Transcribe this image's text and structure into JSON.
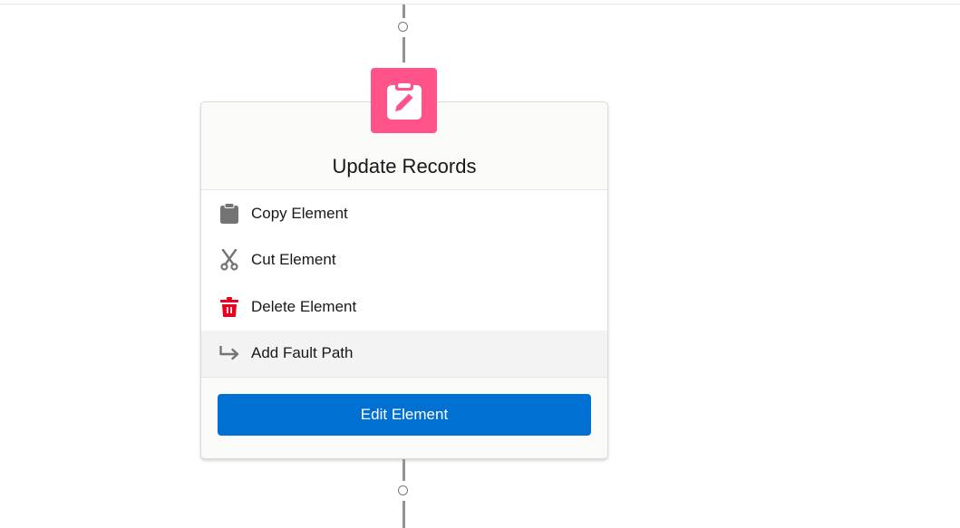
{
  "colors": {
    "element_icon_bg": "#ff538a",
    "primary_button": "#0070d2",
    "neutral_icon": "#747474",
    "delete_icon": "#ea001e"
  },
  "element": {
    "title": "Update Records",
    "icon": "clipboard-edit-icon"
  },
  "menu": {
    "items": [
      {
        "label": "Copy Element",
        "icon": "clipboard-icon"
      },
      {
        "label": "Cut Element",
        "icon": "scissors-icon"
      },
      {
        "label": "Delete Element",
        "icon": "trash-icon"
      },
      {
        "label": "Add Fault Path",
        "icon": "fault-path-arrow-icon",
        "highlighted": true
      }
    ]
  },
  "footer": {
    "edit_button_label": "Edit Element"
  }
}
